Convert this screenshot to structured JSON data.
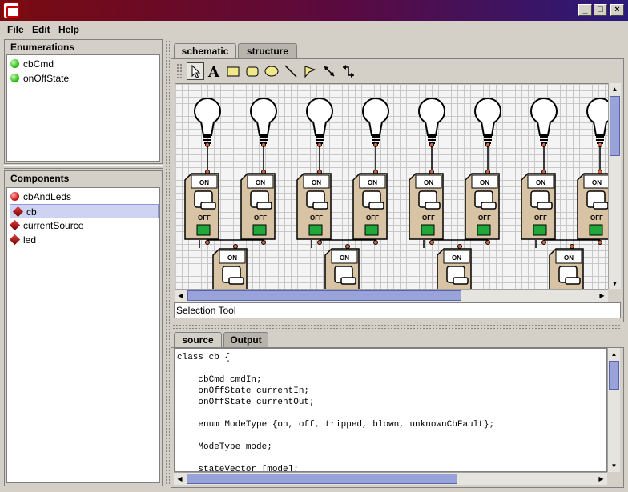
{
  "window": {
    "title": ""
  },
  "menu": [
    "File",
    "Edit",
    "Help"
  ],
  "enumerations": {
    "title": "Enumerations",
    "items": [
      {
        "label": "cbCmd",
        "icon": "green-dot-icon"
      },
      {
        "label": "onOffState",
        "icon": "green-dot-icon"
      }
    ]
  },
  "components": {
    "title": "Components",
    "items": [
      {
        "label": "cbAndLeds",
        "icon": "red-dot-icon",
        "selected": false
      },
      {
        "label": "cb",
        "icon": "red-cube-icon",
        "selected": true
      },
      {
        "label": "currentSource",
        "icon": "red-cube-icon",
        "selected": false
      },
      {
        "label": "led",
        "icon": "red-cube-icon",
        "selected": false
      }
    ]
  },
  "top_tabs": [
    "schematic",
    "structure"
  ],
  "tools": [
    "select-arrow",
    "text",
    "rectangle",
    "rounded-rectangle",
    "ellipse",
    "line",
    "flag",
    "connector-diagonal",
    "connector-elbow"
  ],
  "breaker_labels": {
    "on": "ON",
    "off": "OFF"
  },
  "status_text": "Selection Tool",
  "bottom_tabs": [
    "source",
    "Output"
  ],
  "source_code": [
    "class cb {",
    "",
    "    cbCmd cmdIn;",
    "    onOffState currentIn;",
    "    onOffState currentOut;",
    "",
    "    enum ModeType {on, off, tripped, blown, unknownCbFault};",
    "",
    "    ModeType mode;",
    "",
    "    stateVector [mode];"
  ],
  "colors": {
    "title_gradient_start": "#7a0b10",
    "title_gradient_end": "#2a1a7a",
    "scroll_thumb": "#9aa3d9",
    "breaker_body": "#d8c4a4",
    "breaker_led": "#1ea83a"
  }
}
